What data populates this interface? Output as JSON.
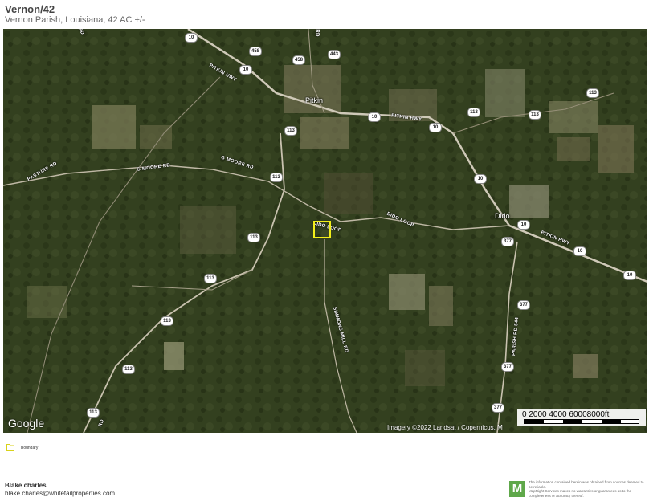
{
  "header": {
    "title": "Vernon/42",
    "subtitle": "Vernon Parish, Louisiana, 42 AC +/-"
  },
  "map": {
    "road_labels": {
      "pitkin_hwy_1": "PITKIN HWY",
      "pitkin_hwy_2": "PITKIN HWY",
      "pitkin_hwy_3": "PITKIN HWY",
      "pasture_rd": "PASTURE RD",
      "g_moore_rd_1": "G MOORE RD",
      "g_moore_rd_2": "G MOORE RD",
      "dido_loop_1": "DIDO LOOP",
      "dido_loop_2": "DIDO LOOP",
      "simmons_mill_rd": "SIMMONS MILL RD",
      "parish_rd_544": "PARISH RD 544",
      "top_left_rd": "RD",
      "top_rd": "RD",
      "bottom_rd": "RD"
    },
    "shields": {
      "h10_a": "10",
      "h10_b": "10",
      "h10_c": "10",
      "h10_d": "10",
      "h10_e": "10",
      "h10_f": "10",
      "h10_g": "10",
      "h10_h": "10",
      "h458_a": "458",
      "h458_b": "458",
      "h443": "443",
      "h113_a": "113",
      "h113_b": "113",
      "h113_c": "113",
      "h113_d": "113",
      "h113_e": "113",
      "h113_f": "113",
      "h113_g": "113",
      "h113_h": "113",
      "h113_i": "113",
      "h113_j": "113",
      "h113_k": "113",
      "h377_a": "377",
      "h377_b": "377",
      "h377_c": "377",
      "h377_d": "377"
    },
    "towns": {
      "pitkin": "Pitkin",
      "dido": "Dido"
    },
    "google": "Google",
    "imagery_credit": "Imagery ©2022 Landsat / Copernicus, M",
    "scale_text": "0    2000  4000  60008000ft"
  },
  "legend": {
    "label": "Boundary",
    "color": "#f2ee1a"
  },
  "agent": {
    "name": "Blake charles",
    "email": "blake.charles@whitetailproperties.com"
  },
  "footer": {
    "logo_letter": "M",
    "logo_color": "#5fa84a",
    "disclaimer_1": "The information contained herein was obtained from sources deemed to be reliable.",
    "disclaimer_2": "MapRight Services makes no warranties or guarantees as to the completeness or accuracy thereof."
  }
}
